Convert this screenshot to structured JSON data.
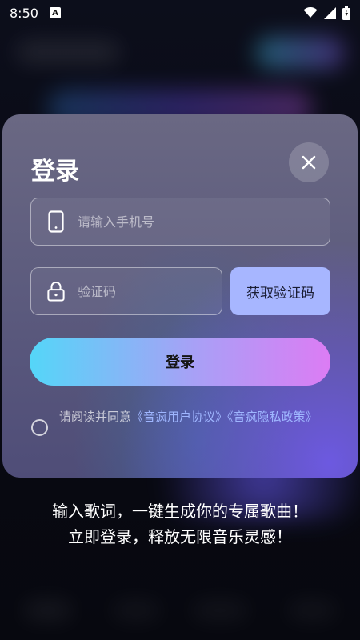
{
  "status_bar": {
    "time": "8:50",
    "app_icon_letter": "A"
  },
  "login_modal": {
    "title": "登录",
    "phone_placeholder": "请输入手机号",
    "code_placeholder": "验证码",
    "get_code_label": "获取验证码",
    "login_label": "登录",
    "agreement": {
      "prefix": "请阅读并同意",
      "user_agreement": "《音疯用户协议》",
      "privacy_policy": "《音疯隐私政策》"
    }
  },
  "slogan": {
    "line1": "输入歌词，一键生成你的专属歌曲！",
    "line2": "立即登录，释放无限音乐灵感！"
  },
  "colors": {
    "accent_link": "#9fb6ff",
    "get_code_bg": "#a7b6ff",
    "gradient_start": "#54d6f8",
    "gradient_end": "#dc7cf4"
  },
  "icons": [
    "phone-icon",
    "lock-icon",
    "close-icon",
    "wifi-icon",
    "signal-icon",
    "battery-icon"
  ]
}
